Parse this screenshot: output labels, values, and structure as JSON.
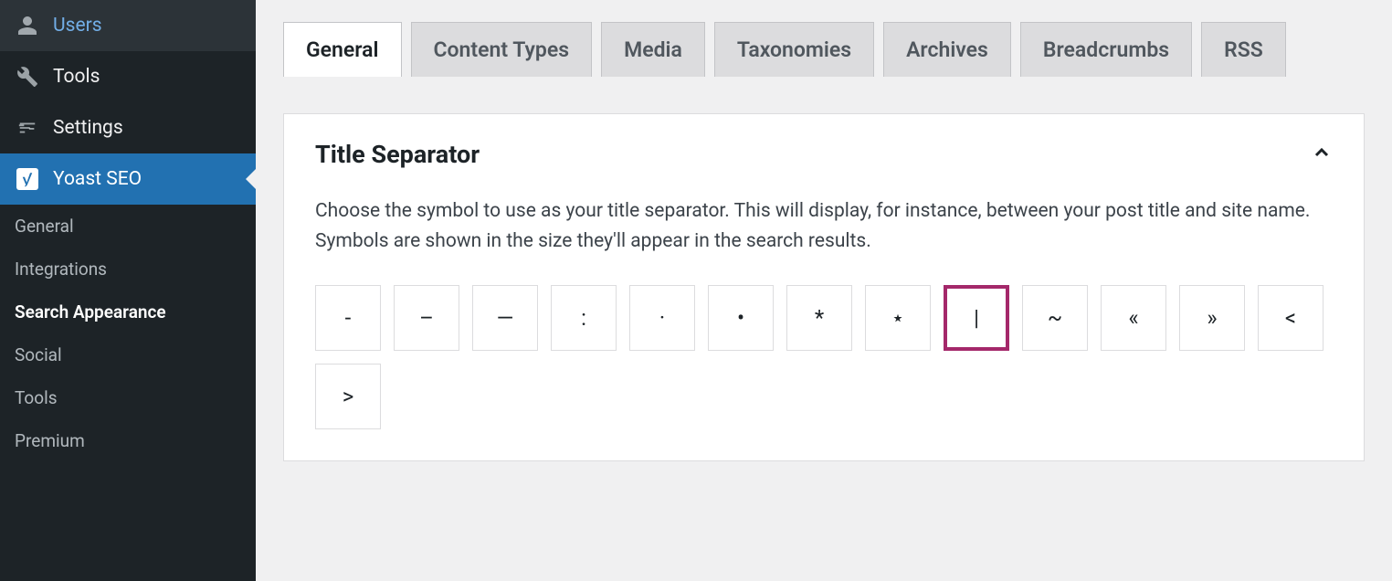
{
  "sidebar": {
    "items": [
      {
        "label": "Users",
        "icon": "users-icon",
        "active": false
      },
      {
        "label": "Tools",
        "icon": "wrench-icon",
        "active": false
      },
      {
        "label": "Settings",
        "icon": "settings-icon",
        "active": false
      },
      {
        "label": "Yoast SEO",
        "icon": "yoast-icon",
        "active": true
      }
    ],
    "subitems": [
      {
        "label": "General",
        "current": false
      },
      {
        "label": "Integrations",
        "current": false
      },
      {
        "label": "Search Appearance",
        "current": true
      },
      {
        "label": "Social",
        "current": false
      },
      {
        "label": "Tools",
        "current": false
      },
      {
        "label": "Premium",
        "current": false
      }
    ]
  },
  "tabs": [
    {
      "label": "General",
      "active": true
    },
    {
      "label": "Content Types",
      "active": false
    },
    {
      "label": "Media",
      "active": false
    },
    {
      "label": "Taxonomies",
      "active": false
    },
    {
      "label": "Archives",
      "active": false
    },
    {
      "label": "Breadcrumbs",
      "active": false
    },
    {
      "label": "RSS",
      "active": false
    }
  ],
  "panel": {
    "title": "Title Separator",
    "description": "Choose the symbol to use as your title separator. This will display, for instance, between your post title and site name. Symbols are shown in the size they'll appear in the search results.",
    "separators": [
      {
        "glyph": "-",
        "name": "dash",
        "selected": false
      },
      {
        "glyph": "–",
        "name": "ndash",
        "selected": false
      },
      {
        "glyph": "—",
        "name": "mdash",
        "selected": false
      },
      {
        "glyph": ":",
        "name": "colon",
        "selected": false
      },
      {
        "glyph": "·",
        "name": "middot",
        "selected": false
      },
      {
        "glyph": "•",
        "name": "bullet",
        "selected": false
      },
      {
        "glyph": "*",
        "name": "asterisk",
        "selected": false
      },
      {
        "glyph": "⋆",
        "name": "star",
        "selected": false
      },
      {
        "glyph": "|",
        "name": "pipe",
        "selected": true
      },
      {
        "glyph": "~",
        "name": "tilde",
        "selected": false
      },
      {
        "glyph": "«",
        "name": "laquo",
        "selected": false
      },
      {
        "glyph": "»",
        "name": "raquo",
        "selected": false
      },
      {
        "glyph": "<",
        "name": "lt",
        "selected": false
      },
      {
        "glyph": ">",
        "name": "gt",
        "selected": false
      }
    ]
  }
}
